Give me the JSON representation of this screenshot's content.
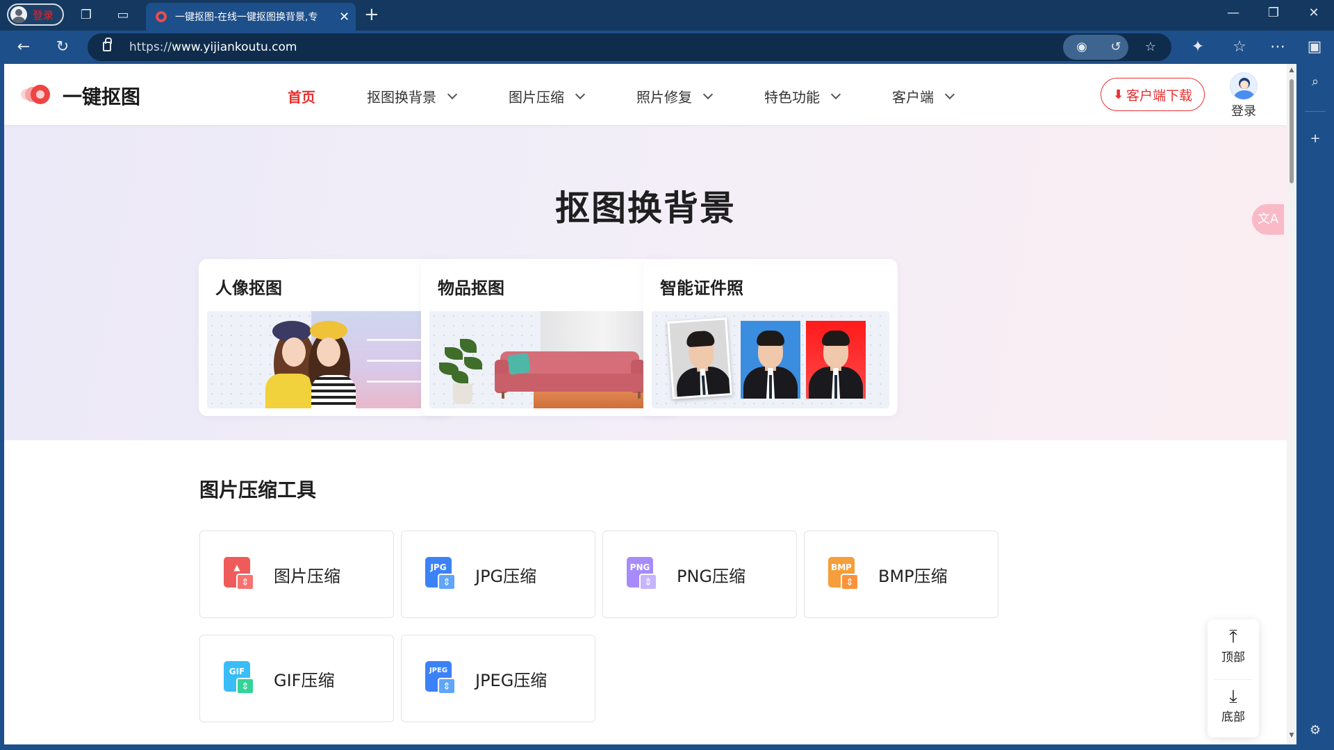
{
  "browser": {
    "profile_label": "登录",
    "tab_title": "一键抠图-在线一键抠图换背景,专",
    "url_prefix": "https://",
    "url_domain": "www.yijiankoutu.com",
    "icons": {
      "collections": "collections-icon",
      "tab_actions": "tab-actions-icon",
      "close_tab": "close-icon",
      "new_tab": "plus-icon",
      "back": "back-arrow-icon",
      "refresh": "refresh-icon",
      "lock": "lock-icon",
      "tracking": "eye-off-icon",
      "immersive": "immersive-reader-icon",
      "favorite": "star-icon",
      "extensions": "puzzle-icon",
      "favorites_list": "favorites-icon",
      "more": "more-icon",
      "sidebar": "sidebar-icon",
      "search": "search-icon",
      "add": "plus-icon",
      "settings": "gear-icon"
    }
  },
  "site": {
    "logo_text": "一键抠图",
    "nav": [
      {
        "label": "首页",
        "active": true
      },
      {
        "label": "抠图换背景",
        "active": false
      },
      {
        "label": "图片压缩",
        "active": false
      },
      {
        "label": "照片修复",
        "active": false
      },
      {
        "label": "特色功能",
        "active": false
      },
      {
        "label": "客户端",
        "active": false
      }
    ],
    "download_label": "客户端下载",
    "login_label": "登录",
    "accent": "#e63030"
  },
  "hero": {
    "title": "抠图换背景",
    "cards": [
      {
        "title": "人像抠图"
      },
      {
        "title": "物品抠图"
      },
      {
        "title": "智能证件照"
      }
    ],
    "translate_icon": "translate-icon"
  },
  "tools": {
    "section_title": "图片压缩工具",
    "items": [
      {
        "label": "图片压缩",
        "badge": "",
        "color": "#ef5b5b"
      },
      {
        "label": "JPG压缩",
        "badge": "JPG",
        "color": "#3b82f6"
      },
      {
        "label": "PNG压缩",
        "badge": "PNG",
        "color": "#a78bfa"
      },
      {
        "label": "BMP压缩",
        "badge": "BMP",
        "color": "#f59e3b"
      },
      {
        "label": "GIF压缩",
        "badge": "GIF",
        "color": "#38bdf8"
      },
      {
        "label": "JPEG压缩",
        "badge": "JPEG",
        "color": "#3b82f6"
      }
    ]
  },
  "float_nav": {
    "top_label": "顶部",
    "bottom_label": "底部"
  }
}
